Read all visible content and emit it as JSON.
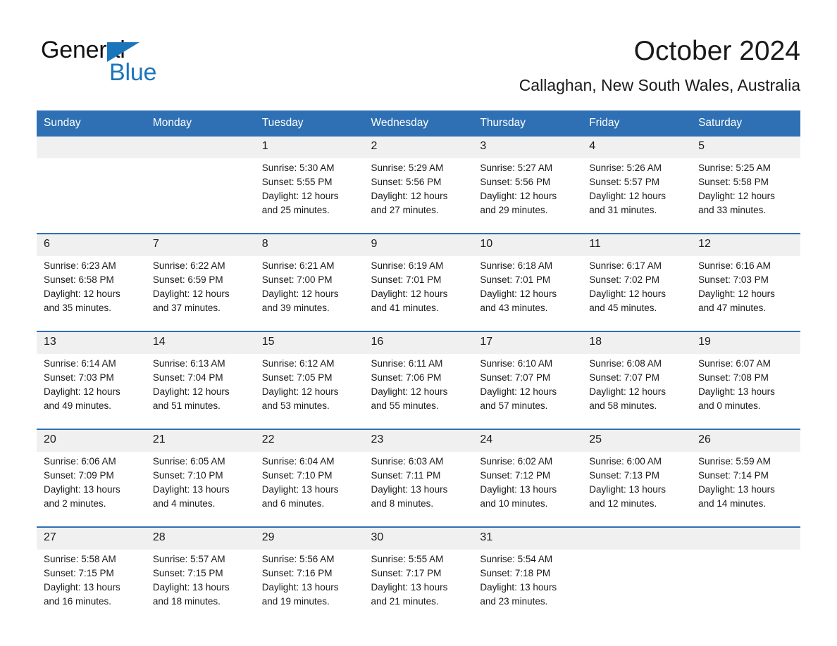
{
  "brand": {
    "word_one": "General",
    "word_two": "Blue",
    "triangle_color": "#1B75BB"
  },
  "header": {
    "title": "October 2024",
    "subtitle": "Callaghan, New South Wales, Australia"
  },
  "theme": {
    "header_blue": "#2E70B3",
    "daynum_band": "#F0F0F0",
    "text": "#1a1a1a"
  },
  "weekday_headers": [
    "Sunday",
    "Monday",
    "Tuesday",
    "Wednesday",
    "Thursday",
    "Friday",
    "Saturday"
  ],
  "weeks": [
    [
      {
        "day": "",
        "sunrise": "",
        "sunset": "",
        "daylight_1": "",
        "daylight_2": ""
      },
      {
        "day": "",
        "sunrise": "",
        "sunset": "",
        "daylight_1": "",
        "daylight_2": ""
      },
      {
        "day": "1",
        "sunrise": "Sunrise: 5:30 AM",
        "sunset": "Sunset: 5:55 PM",
        "daylight_1": "Daylight: 12 hours",
        "daylight_2": "and 25 minutes."
      },
      {
        "day": "2",
        "sunrise": "Sunrise: 5:29 AM",
        "sunset": "Sunset: 5:56 PM",
        "daylight_1": "Daylight: 12 hours",
        "daylight_2": "and 27 minutes."
      },
      {
        "day": "3",
        "sunrise": "Sunrise: 5:27 AM",
        "sunset": "Sunset: 5:56 PM",
        "daylight_1": "Daylight: 12 hours",
        "daylight_2": "and 29 minutes."
      },
      {
        "day": "4",
        "sunrise": "Sunrise: 5:26 AM",
        "sunset": "Sunset: 5:57 PM",
        "daylight_1": "Daylight: 12 hours",
        "daylight_2": "and 31 minutes."
      },
      {
        "day": "5",
        "sunrise": "Sunrise: 5:25 AM",
        "sunset": "Sunset: 5:58 PM",
        "daylight_1": "Daylight: 12 hours",
        "daylight_2": "and 33 minutes."
      }
    ],
    [
      {
        "day": "6",
        "sunrise": "Sunrise: 6:23 AM",
        "sunset": "Sunset: 6:58 PM",
        "daylight_1": "Daylight: 12 hours",
        "daylight_2": "and 35 minutes."
      },
      {
        "day": "7",
        "sunrise": "Sunrise: 6:22 AM",
        "sunset": "Sunset: 6:59 PM",
        "daylight_1": "Daylight: 12 hours",
        "daylight_2": "and 37 minutes."
      },
      {
        "day": "8",
        "sunrise": "Sunrise: 6:21 AM",
        "sunset": "Sunset: 7:00 PM",
        "daylight_1": "Daylight: 12 hours",
        "daylight_2": "and 39 minutes."
      },
      {
        "day": "9",
        "sunrise": "Sunrise: 6:19 AM",
        "sunset": "Sunset: 7:01 PM",
        "daylight_1": "Daylight: 12 hours",
        "daylight_2": "and 41 minutes."
      },
      {
        "day": "10",
        "sunrise": "Sunrise: 6:18 AM",
        "sunset": "Sunset: 7:01 PM",
        "daylight_1": "Daylight: 12 hours",
        "daylight_2": "and 43 minutes."
      },
      {
        "day": "11",
        "sunrise": "Sunrise: 6:17 AM",
        "sunset": "Sunset: 7:02 PM",
        "daylight_1": "Daylight: 12 hours",
        "daylight_2": "and 45 minutes."
      },
      {
        "day": "12",
        "sunrise": "Sunrise: 6:16 AM",
        "sunset": "Sunset: 7:03 PM",
        "daylight_1": "Daylight: 12 hours",
        "daylight_2": "and 47 minutes."
      }
    ],
    [
      {
        "day": "13",
        "sunrise": "Sunrise: 6:14 AM",
        "sunset": "Sunset: 7:03 PM",
        "daylight_1": "Daylight: 12 hours",
        "daylight_2": "and 49 minutes."
      },
      {
        "day": "14",
        "sunrise": "Sunrise: 6:13 AM",
        "sunset": "Sunset: 7:04 PM",
        "daylight_1": "Daylight: 12 hours",
        "daylight_2": "and 51 minutes."
      },
      {
        "day": "15",
        "sunrise": "Sunrise: 6:12 AM",
        "sunset": "Sunset: 7:05 PM",
        "daylight_1": "Daylight: 12 hours",
        "daylight_2": "and 53 minutes."
      },
      {
        "day": "16",
        "sunrise": "Sunrise: 6:11 AM",
        "sunset": "Sunset: 7:06 PM",
        "daylight_1": "Daylight: 12 hours",
        "daylight_2": "and 55 minutes."
      },
      {
        "day": "17",
        "sunrise": "Sunrise: 6:10 AM",
        "sunset": "Sunset: 7:07 PM",
        "daylight_1": "Daylight: 12 hours",
        "daylight_2": "and 57 minutes."
      },
      {
        "day": "18",
        "sunrise": "Sunrise: 6:08 AM",
        "sunset": "Sunset: 7:07 PM",
        "daylight_1": "Daylight: 12 hours",
        "daylight_2": "and 58 minutes."
      },
      {
        "day": "19",
        "sunrise": "Sunrise: 6:07 AM",
        "sunset": "Sunset: 7:08 PM",
        "daylight_1": "Daylight: 13 hours",
        "daylight_2": "and 0 minutes."
      }
    ],
    [
      {
        "day": "20",
        "sunrise": "Sunrise: 6:06 AM",
        "sunset": "Sunset: 7:09 PM",
        "daylight_1": "Daylight: 13 hours",
        "daylight_2": "and 2 minutes."
      },
      {
        "day": "21",
        "sunrise": "Sunrise: 6:05 AM",
        "sunset": "Sunset: 7:10 PM",
        "daylight_1": "Daylight: 13 hours",
        "daylight_2": "and 4 minutes."
      },
      {
        "day": "22",
        "sunrise": "Sunrise: 6:04 AM",
        "sunset": "Sunset: 7:10 PM",
        "daylight_1": "Daylight: 13 hours",
        "daylight_2": "and 6 minutes."
      },
      {
        "day": "23",
        "sunrise": "Sunrise: 6:03 AM",
        "sunset": "Sunset: 7:11 PM",
        "daylight_1": "Daylight: 13 hours",
        "daylight_2": "and 8 minutes."
      },
      {
        "day": "24",
        "sunrise": "Sunrise: 6:02 AM",
        "sunset": "Sunset: 7:12 PM",
        "daylight_1": "Daylight: 13 hours",
        "daylight_2": "and 10 minutes."
      },
      {
        "day": "25",
        "sunrise": "Sunrise: 6:00 AM",
        "sunset": "Sunset: 7:13 PM",
        "daylight_1": "Daylight: 13 hours",
        "daylight_2": "and 12 minutes."
      },
      {
        "day": "26",
        "sunrise": "Sunrise: 5:59 AM",
        "sunset": "Sunset: 7:14 PM",
        "daylight_1": "Daylight: 13 hours",
        "daylight_2": "and 14 minutes."
      }
    ],
    [
      {
        "day": "27",
        "sunrise": "Sunrise: 5:58 AM",
        "sunset": "Sunset: 7:15 PM",
        "daylight_1": "Daylight: 13 hours",
        "daylight_2": "and 16 minutes."
      },
      {
        "day": "28",
        "sunrise": "Sunrise: 5:57 AM",
        "sunset": "Sunset: 7:15 PM",
        "daylight_1": "Daylight: 13 hours",
        "daylight_2": "and 18 minutes."
      },
      {
        "day": "29",
        "sunrise": "Sunrise: 5:56 AM",
        "sunset": "Sunset: 7:16 PM",
        "daylight_1": "Daylight: 13 hours",
        "daylight_2": "and 19 minutes."
      },
      {
        "day": "30",
        "sunrise": "Sunrise: 5:55 AM",
        "sunset": "Sunset: 7:17 PM",
        "daylight_1": "Daylight: 13 hours",
        "daylight_2": "and 21 minutes."
      },
      {
        "day": "31",
        "sunrise": "Sunrise: 5:54 AM",
        "sunset": "Sunset: 7:18 PM",
        "daylight_1": "Daylight: 13 hours",
        "daylight_2": "and 23 minutes."
      },
      {
        "day": "",
        "sunrise": "",
        "sunset": "",
        "daylight_1": "",
        "daylight_2": ""
      },
      {
        "day": "",
        "sunrise": "",
        "sunset": "",
        "daylight_1": "",
        "daylight_2": ""
      }
    ]
  ]
}
